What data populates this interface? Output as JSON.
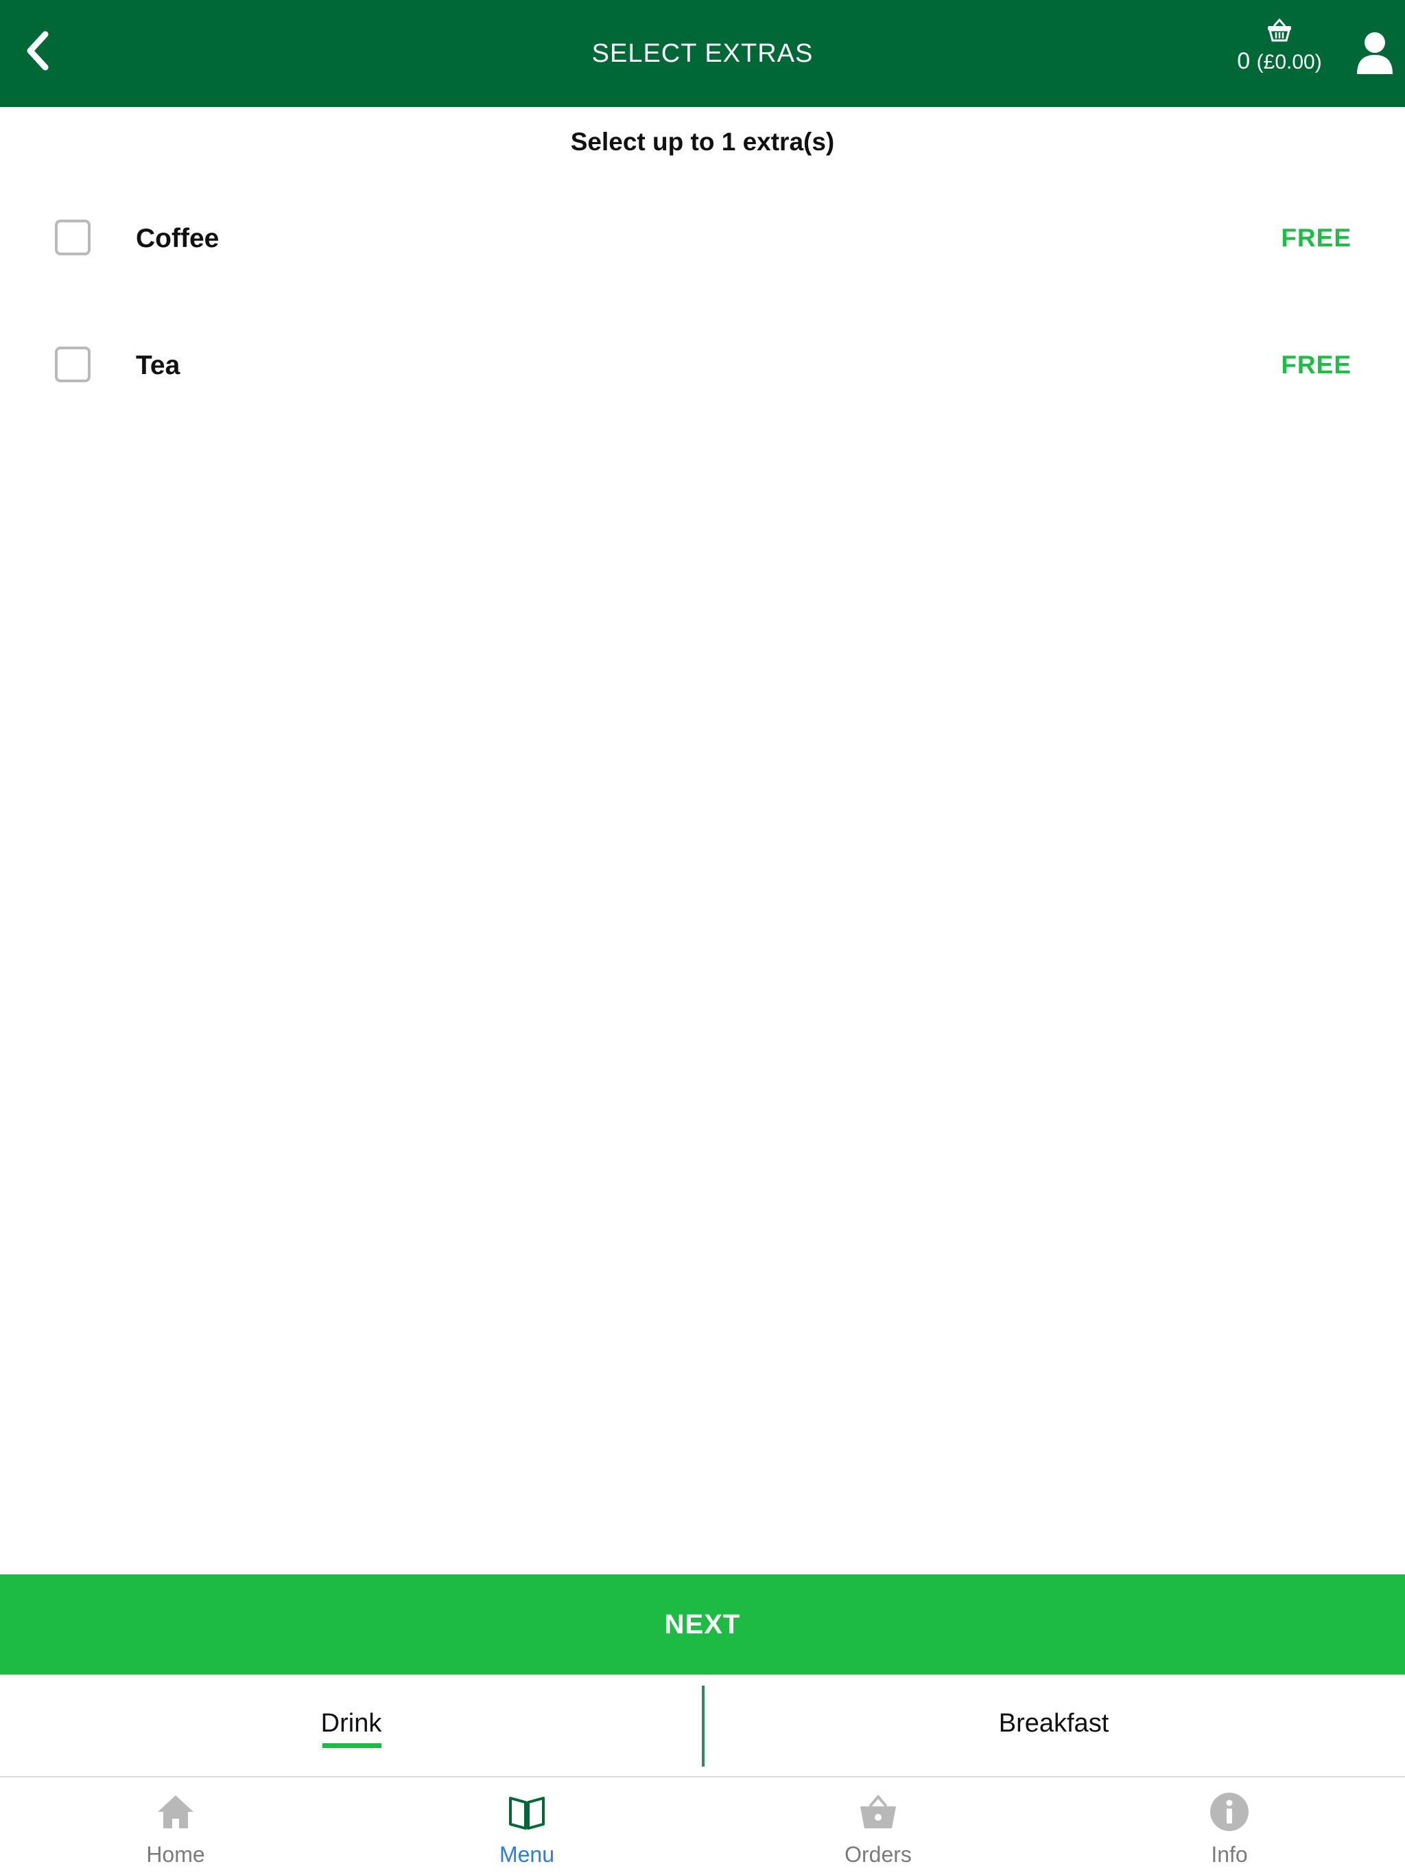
{
  "header": {
    "title": "SELECT EXTRAS",
    "basket_count": "0",
    "basket_total": "(£0.00)"
  },
  "subheading": "Select up to 1 extra(s)",
  "options": [
    {
      "name": "Coffee",
      "price": "FREE",
      "checked": false
    },
    {
      "name": "Tea",
      "price": "FREE",
      "checked": false
    }
  ],
  "next_label": "NEXT",
  "categories": [
    {
      "label": "Drink",
      "active": true
    },
    {
      "label": "Breakfast",
      "active": false
    }
  ],
  "nav": [
    {
      "label": "Home",
      "icon": "home-icon"
    },
    {
      "label": "Menu",
      "icon": "book-icon",
      "active": true
    },
    {
      "label": "Orders",
      "icon": "basket-icon"
    },
    {
      "label": "Info",
      "icon": "info-icon"
    }
  ],
  "colors": {
    "header_bg": "#006837",
    "accent_green": "#1dbb44",
    "active_nav": "#2a7de1",
    "inactive_nav": "#7b7b7b"
  }
}
